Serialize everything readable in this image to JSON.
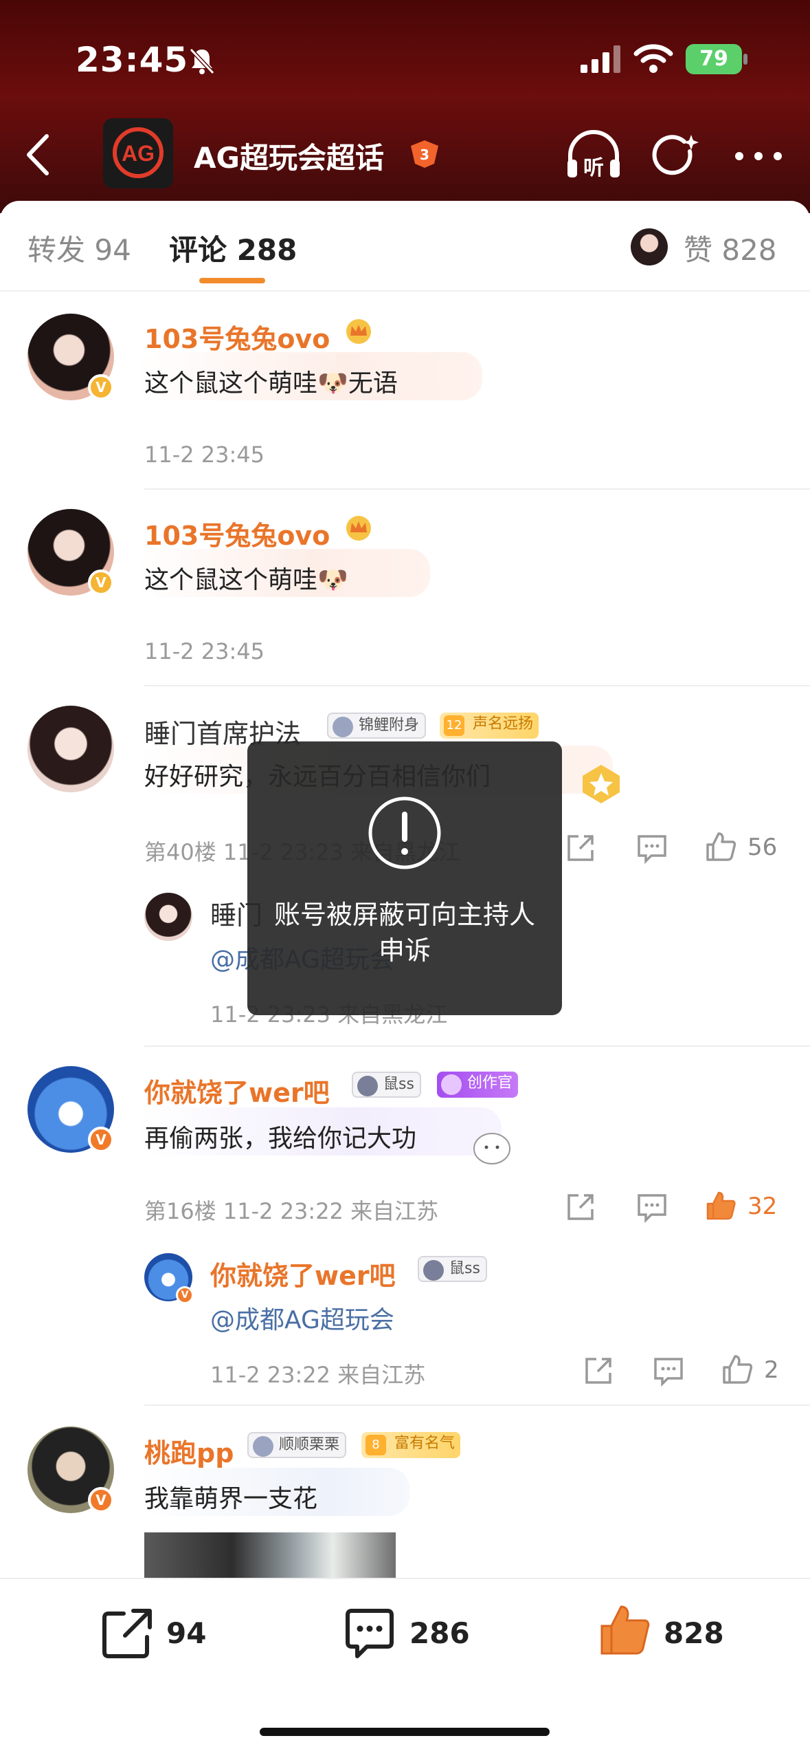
{
  "status_bar": {
    "time": "23:45",
    "battery": "79"
  },
  "header": {
    "title": "AG超玩会超话",
    "logo_text": "AG"
  },
  "tabs": {
    "repost": "转发 94",
    "comment": "评论 288",
    "like": "赞 828"
  },
  "comments": [
    {
      "user": "103号兔兔ovo",
      "text": "这个鼠这个萌哇🐶无语",
      "time": "11-2 23:45"
    },
    {
      "user": "103号兔兔ovo",
      "text": "这个鼠这个萌哇🐶",
      "time": "11-2 23:45"
    },
    {
      "user": "睡门首席护法",
      "tags": [
        "锦鲤附身",
        "声名远扬"
      ],
      "tag_level": "12",
      "text": "好好研究，永远百分百相信你们",
      "meta": "第40楼 11-2 23:23 来自黑龙江",
      "likes": "56",
      "reply": {
        "user": "睡门",
        "mention": "@成都AG超玩会",
        "meta": "11-2 23:23 来自黑龙江"
      }
    },
    {
      "user": "你就饶了wer吧",
      "tags": [
        "鼠ss",
        "创作官"
      ],
      "text": "再偷两张，我给你记大功",
      "meta": "第16楼 11-2 23:22 来自江苏",
      "likes": "32",
      "reply": {
        "user": "你就饶了wer吧",
        "tag": "鼠ss",
        "mention": "@成都AG超玩会",
        "meta": "11-2 23:22 来自江苏",
        "likes": "2"
      }
    },
    {
      "user": "桃跑pp",
      "tags": [
        "顺顺栗栗",
        "富有名气"
      ],
      "tag_level": "8",
      "text": "我靠萌界一支花"
    }
  ],
  "toast": {
    "message": "账号被屏蔽可向主持人申诉"
  },
  "bottom_bar": {
    "repost_count": "94",
    "comment_count": "286",
    "like_count": "828"
  },
  "colors": {
    "accent": "#e9752a",
    "header_bg": "#5a0a0a",
    "creator_tag": "#a54df0"
  }
}
